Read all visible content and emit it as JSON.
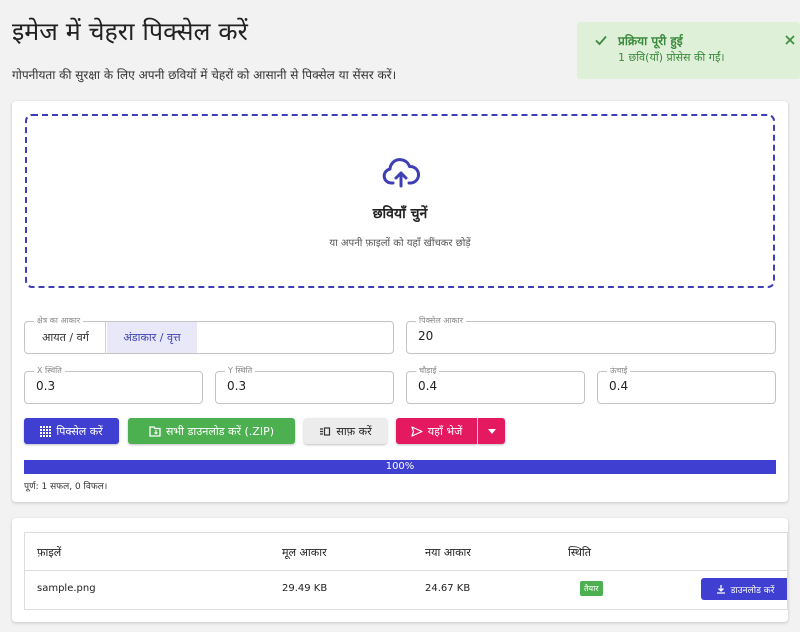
{
  "header": {
    "title": "इमेज में चेहरा पिक्सेल करें",
    "subtitle": "गोपनीयता की सुरक्षा के लिए अपनी छवियों में चेहरों को आसानी से पिक्सेल या सेंसर करें।"
  },
  "toast": {
    "title": "प्रक्रिया पूरी हुई",
    "message": "1 छवि(याँ) प्रोसेस की गईं।",
    "color": "#3c8a3e",
    "background": "#dff0d8"
  },
  "dropzone": {
    "title": "छवियाँ चुनें",
    "subtitle": "या अपनी फ़ाइलों को यहाँ खींचकर छोड़ें",
    "icon": "cloud-upload-icon"
  },
  "settings": {
    "region_shape": {
      "label": "क्षेत्र का आकार",
      "options": [
        "आयत / वर्ग",
        "अंडाकार / वृत्त"
      ],
      "selected": "अंडाकार / वृत्त"
    },
    "pixel_size": {
      "label": "पिक्सेल आकार",
      "value": "20"
    },
    "x_pos": {
      "label": "X स्थिति",
      "value": "0.3"
    },
    "y_pos": {
      "label": "Y स्थिति",
      "value": "0.3"
    },
    "width": {
      "label": "चौड़ाई",
      "value": "0.4"
    },
    "height": {
      "label": "ऊंचाई",
      "value": "0.4"
    }
  },
  "actions": {
    "pixelate": "पिक्सेल करें",
    "download_zip": "सभी डाउनलोड करें (.ZIP)",
    "clear": "साफ़ करें",
    "send_here": "यहाँ भेजें"
  },
  "progress": {
    "percent": 100,
    "label": "100%",
    "summary": "पूर्ण: 1 सफल, 0 विफल।"
  },
  "table": {
    "headers": [
      "फ़ाइलें",
      "मूल आकार",
      "नया आकार",
      "स्थिति"
    ],
    "rows": [
      {
        "file": "sample.png",
        "original_size": "29.49 KB",
        "new_size": "24.67 KB",
        "status": "तैयार",
        "action": "डाउनलोड करें"
      }
    ]
  },
  "colors": {
    "accent": "#3f3fd1",
    "success": "#4caf50",
    "danger": "#e5195f"
  }
}
